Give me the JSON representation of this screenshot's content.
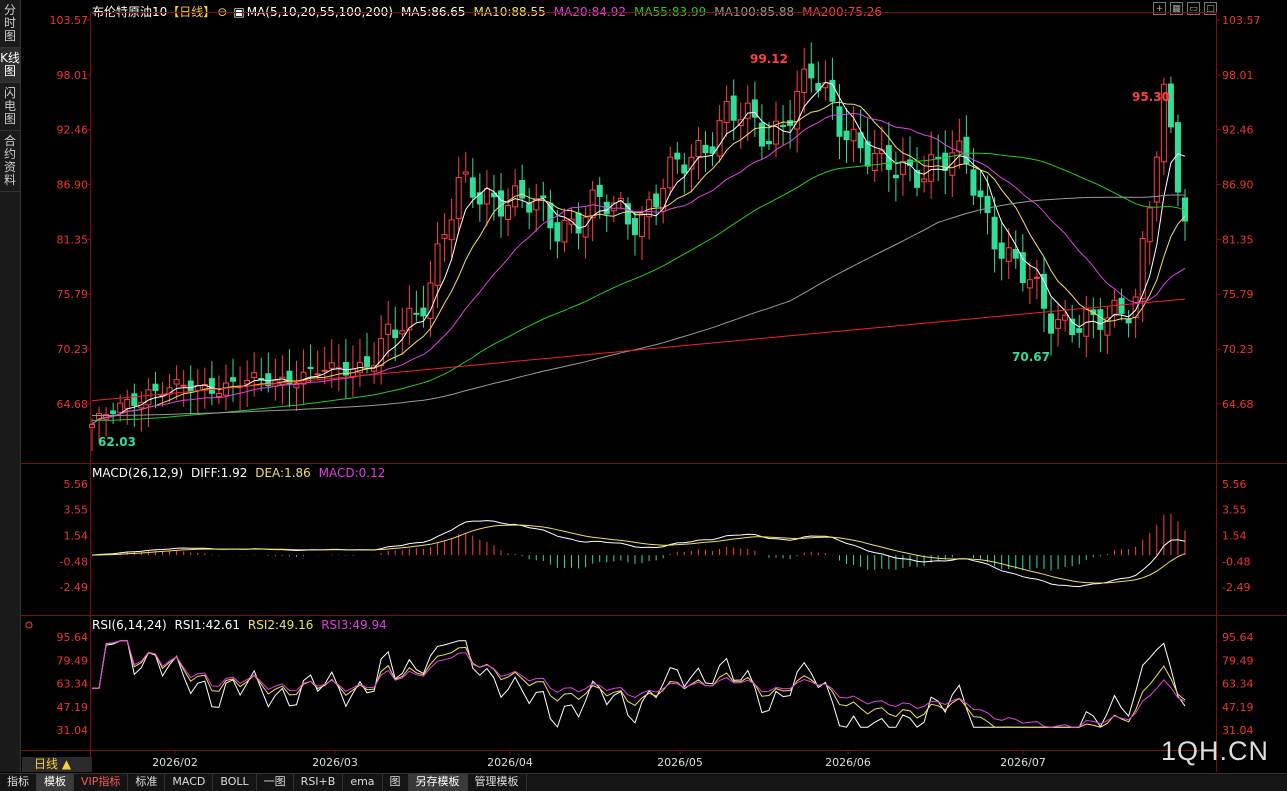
{
  "sidebar": [
    "分时图",
    "K线图",
    "闪电图",
    "合约资料"
  ],
  "header": {
    "title": "布伦特原油10",
    "period": "【日线】",
    "ma_label": "MA(5,10,20,55,100,200)",
    "ma5": "MA5:86.65",
    "ma10": "MA10:88.55",
    "ma20": "MA20:84.92",
    "ma55": "MA55:83.99",
    "ma100": "MA100:85.88",
    "ma200": "MA200:75.26"
  },
  "price_axis": [
    "103.57",
    "98.01",
    "92.46",
    "86.90",
    "81.35",
    "75.79",
    "70.23",
    "64.68"
  ],
  "annotations": {
    "high1": "99.12",
    "high2": "95.30",
    "low1": "62.03",
    "low2": "70.67"
  },
  "macd": {
    "label": "MACD(26,12,9)",
    "diff": "DIFF:1.92",
    "dea": "DEA:1.86",
    "macd": "MACD:0.12",
    "axis": [
      "5.56",
      "3.55",
      "1.54",
      "-0.48",
      "-2.49"
    ]
  },
  "rsi": {
    "label": "RSI(6,14,24)",
    "rsi1": "RSI1:42.61",
    "rsi2": "RSI2:49.16",
    "rsi3": "RSI3:49.94",
    "axis": [
      "95.64",
      "79.49",
      "63.34",
      "47.19",
      "31.04"
    ]
  },
  "time_axis": [
    "2026/02",
    "2026/03",
    "2026/04",
    "2026/05",
    "2026/06",
    "2026/07"
  ],
  "bottom_tabs": [
    "指标",
    "模板",
    "VIP指标",
    "标准",
    "MACD",
    "BOLL",
    "一图",
    "RSI+B",
    "ema",
    "图",
    "另存模板",
    "管理模板"
  ],
  "day_tab": "日线 ▲",
  "logo": "1QH.CN",
  "colors": {
    "up": "#ff4040",
    "down": "#33dd99",
    "ma5": "#ffffff",
    "ma10": "#f0e060",
    "ma20": "#e040e0",
    "ma55": "#22cc22",
    "ma100": "#999999",
    "ma200": "#ee2222"
  },
  "chart_data": {
    "type": "candlestick",
    "x": [
      "2026/01/23",
      "2026/02/01",
      "2026/02/10",
      "2026/02/20",
      "2026/03/01",
      "2026/03/10",
      "2026/03/16",
      "2026/03/22",
      "2026/04/01",
      "2026/04/08",
      "2026/04/15",
      "2026/04/22",
      "2026/05/01",
      "2026/05/08",
      "2026/05/15",
      "2026/05/20",
      "2026/05/27",
      "2026/06/03",
      "2026/06/10",
      "2026/06/17",
      "2026/06/24",
      "2026/07/01",
      "2026/07/06",
      "2026/07/13",
      "2026/07/20",
      "2026/07/25"
    ],
    "close": [
      62.5,
      66.0,
      66.5,
      67.5,
      69.0,
      74.0,
      86.0,
      86.0,
      83.0,
      84.5,
      84.0,
      94.0,
      92.0,
      97.5,
      92.0,
      88.0,
      89.0,
      89.0,
      79.0,
      74.0,
      72.0,
      76.0,
      85.0,
      95.0,
      87.0,
      83.2
    ],
    "ylim": [
      62.03,
      103.57
    ]
  }
}
